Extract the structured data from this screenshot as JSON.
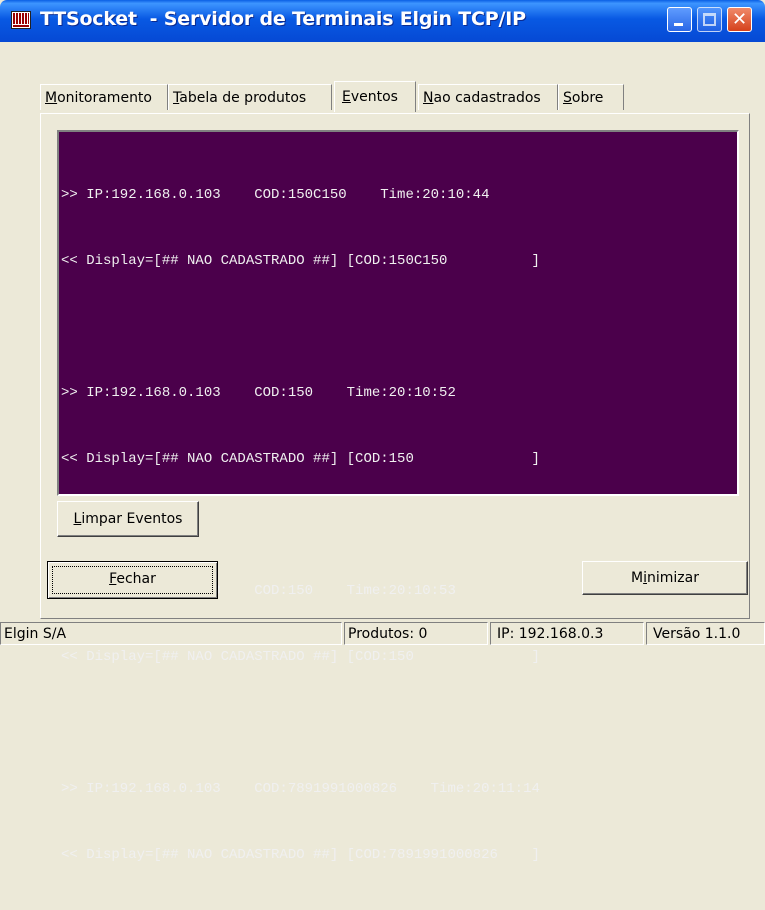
{
  "window": {
    "title": "TTSocket  - Servidor de Terminais Elgin TCP/IP"
  },
  "tabs": [
    {
      "pre": "",
      "accel": "M",
      "post": "onitoramento"
    },
    {
      "pre": "",
      "accel": "T",
      "post": "abela de produtos"
    },
    {
      "pre": "",
      "accel": "E",
      "post": "ventos"
    },
    {
      "pre": "",
      "accel": "N",
      "post": "ao cadastrados"
    },
    {
      "pre": "",
      "accel": "S",
      "post": "obre"
    }
  ],
  "active_tab": "Eventos",
  "events": [
    {
      "in": ">> IP:192.168.0.103    COD:150C150    Time:20:10:44",
      "out": "<< Display=[## NAO CADASTRADO ##] [COD:150C150          ]"
    },
    {
      "in": ">> IP:192.168.0.103    COD:150    Time:20:10:52",
      "out": "<< Display=[## NAO CADASTRADO ##] [COD:150              ]"
    },
    {
      "in": ">> IP:192.168.0.103    COD:150    Time:20:10:53",
      "out": "<< Display=[## NAO CADASTRADO ##] [COD:150              ]"
    },
    {
      "in": ">> IP:192.168.0.103    COD:7891991000826    Time:20:11:14",
      "out": "<< Display=[## NAO CADASTRADO ##] [COD:7891991000826    ]"
    }
  ],
  "buttons": {
    "limpar": {
      "accel": "L",
      "rest": "impar Eventos"
    },
    "fechar": {
      "accel": "F",
      "rest": "echar"
    },
    "minimizar": {
      "pre": "M",
      "accel": "i",
      "rest": "nimizar"
    }
  },
  "status": {
    "company": "Elgin S/A",
    "produtos": "Produtos: 0",
    "ip": "IP: 192.168.0.3",
    "versao": "Versão 1.1.0"
  },
  "colors": {
    "log_background": "#4b004b",
    "log_text": "#f0f0f0",
    "titlebar": "#0859e3"
  }
}
